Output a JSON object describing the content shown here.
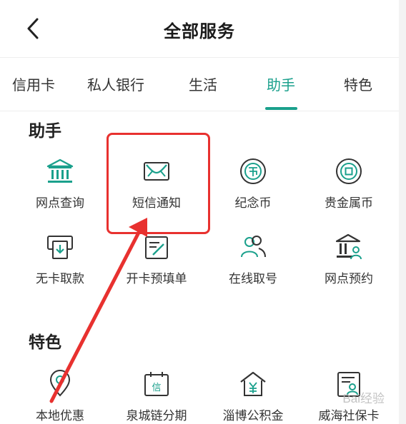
{
  "header": {
    "title": "全部服务"
  },
  "tabs": [
    {
      "label": "信用卡"
    },
    {
      "label": "私人银行"
    },
    {
      "label": "生活"
    },
    {
      "label": "助手",
      "active": true
    },
    {
      "label": "特色"
    }
  ],
  "sections": {
    "assistant": {
      "title": "助手",
      "items": [
        {
          "label": "网点查询",
          "icon": "bank-building-icon"
        },
        {
          "label": "短信通知",
          "icon": "sms-envelope-icon"
        },
        {
          "label": "纪念币",
          "icon": "coin-icon"
        },
        {
          "label": "贵金属币",
          "icon": "precious-metal-coin-icon"
        },
        {
          "label": "无卡取款",
          "icon": "cardless-withdrawal-icon"
        },
        {
          "label": "开卡预填单",
          "icon": "form-prefill-icon"
        },
        {
          "label": "在线取号",
          "icon": "queue-ticket-icon"
        },
        {
          "label": "网点预约",
          "icon": "branch-appointment-icon"
        }
      ]
    },
    "featured": {
      "title": "特色",
      "items": [
        {
          "label": "本地优惠",
          "icon": "location-pin-icon"
        },
        {
          "label": "泉城链分期",
          "icon": "calendar-installment-icon"
        },
        {
          "label": "淄博公积金",
          "icon": "housing-fund-icon"
        },
        {
          "label": "威海社保卡",
          "icon": "social-security-card-icon"
        }
      ]
    }
  },
  "annotation": {
    "highlight_color": "#e8312f",
    "target": "短信通知"
  },
  "colors": {
    "accent": "#1aa08c"
  },
  "watermark": "Bai经验"
}
